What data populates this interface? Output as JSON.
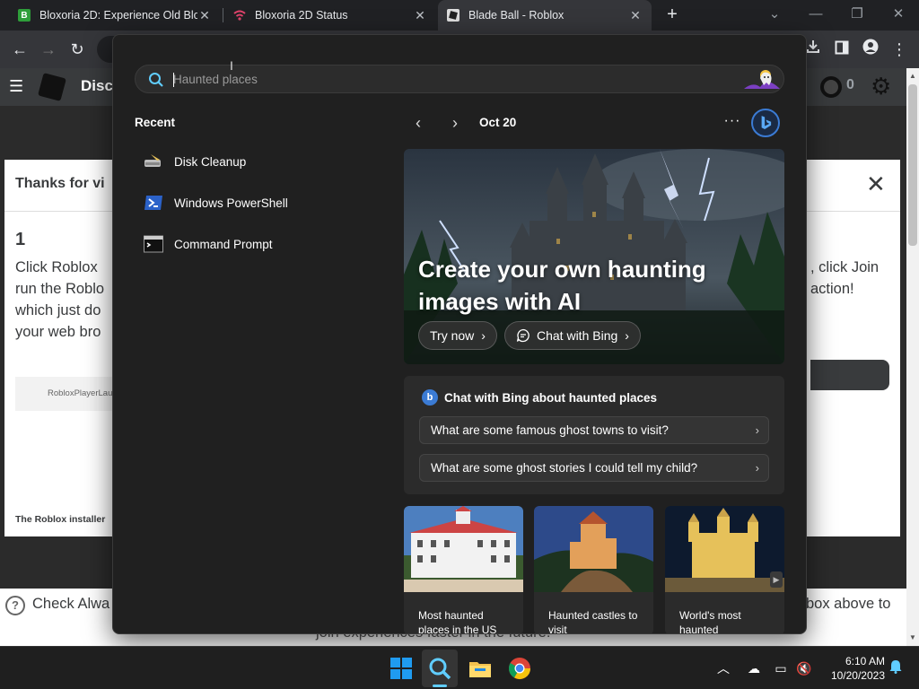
{
  "browser": {
    "tabs": [
      {
        "title": "Bloxoria 2D: Experience Old Blox",
        "favicon": "B",
        "active": false
      },
      {
        "title": "Bloxoria 2D Status",
        "active": false
      },
      {
        "title": "Blade Ball - Roblox",
        "active": true
      }
    ],
    "new_tab_glyph": "+",
    "icons": {
      "back": "back-arrow-icon",
      "forward": "forward-arrow-icon",
      "reload": "reload-icon",
      "download": "download-icon",
      "sidepanel": "side-panel-icon",
      "profile": "profile-icon",
      "menu": "kebab-menu-icon"
    }
  },
  "background_page": {
    "nav_text": "Disc",
    "robux_count": "0",
    "modal": {
      "title": "Thanks for vi",
      "step": "1",
      "left_lines": [
        "Click Roblox",
        "run the Roblo",
        "which just do",
        "your web bro"
      ],
      "right_lines": [
        ", click Join",
        "action!"
      ],
      "file_name": "RobloxPlayerLau",
      "installer_note": "The Roblox installer"
    },
    "footer": {
      "check_text": "Check Alwa",
      "check_text_right": "box above to",
      "join_text": "join experiences faster in the future!"
    }
  },
  "search": {
    "placeholder": "Haunted places",
    "recent_header": "Recent",
    "recent": [
      {
        "label": "Disk Cleanup",
        "icon": "disk-cleanup-icon"
      },
      {
        "label": "Windows PowerShell",
        "icon": "powershell-icon"
      },
      {
        "label": "Command Prompt",
        "icon": "command-prompt-icon"
      }
    ],
    "date": "Oct 20",
    "more": "···",
    "hero": {
      "title": "Create your own haunting images with AI",
      "try_now": "Try now",
      "chat_with_bing": "Chat with Bing"
    },
    "chat_card": {
      "header": "Chat with Bing about haunted places",
      "questions": [
        "What are some famous ghost towns to visit?",
        "What are some ghost stories I could tell my child?"
      ]
    },
    "thumbnails": [
      {
        "caption": "Most haunted places in the US"
      },
      {
        "caption": "Haunted castles to visit"
      },
      {
        "caption": "World's most haunted"
      }
    ]
  },
  "taskbar": {
    "apps": [
      "windows-start-icon",
      "search-icon",
      "file-explorer-icon",
      "chrome-icon"
    ],
    "time": "6:10 AM",
    "date": "10/20/2023"
  },
  "colors": {
    "flyout_bg": "#202020",
    "accent": "#60cdff",
    "bing_blue": "#3b7bd4"
  }
}
